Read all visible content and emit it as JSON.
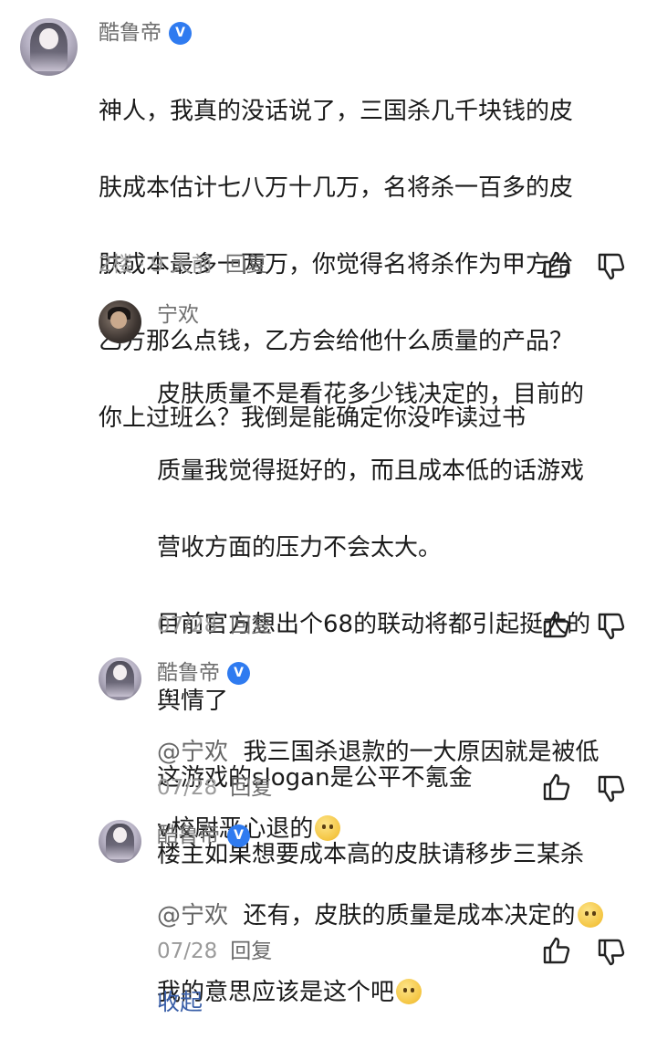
{
  "main_comment": {
    "user": "酷鲁帝",
    "verified": true,
    "lines": [
      "神人，我真的没话说了，三国杀几千块钱的皮",
      "肤成本估计七八万十几万，名将杀一百多的皮",
      "肤成本最多一两万，你觉得名将杀作为甲方给",
      "乙方那么点钱，乙方会给他什么质量的产品？",
      "你上过班么？我倒是能确定你没咋读过书"
    ],
    "floor": "2楼",
    "separator": "·",
    "time": "9 天前",
    "reply_label": "回复"
  },
  "replies": [
    {
      "user": "宁欢",
      "verified": false,
      "lines": [
        "皮肤质量不是看花多少钱决定的，目前的",
        "质量我觉得挺好的，而且成本低的话游戏",
        "营收方面的压力不会太大。",
        "目前官方想出个68的联动将都引起挺大的",
        "舆情了",
        "这游戏的slogan是公平不氪金",
        "楼主如果想要成本高的皮肤请移步三某杀"
      ],
      "date": "07/28",
      "reply_label": "回复"
    },
    {
      "user": "酷鲁帝",
      "verified": true,
      "mention": "@宁欢",
      "line1": "我三国杀退款的一大原因就是被低",
      "line2": "v校尉恶心退的",
      "date": "07/28",
      "reply_label": "回复"
    },
    {
      "user": "酷鲁帝",
      "verified": true,
      "mention": "@宁欢",
      "line1": "还有，皮肤的质量是成本决定的",
      "line2": "我的意思应该是这个吧",
      "date": "07/28",
      "reply_label": "回复"
    }
  ],
  "collapse_label": "收起",
  "icons": {
    "like": "thumbs-up-icon",
    "dislike": "thumbs-down-icon",
    "verified": "verified-badge-icon",
    "emoji": "emoji-icon"
  },
  "colors": {
    "verified_badge": "#2f7bf0",
    "link": "#3a5fa8",
    "meta": "#9a9a9a"
  }
}
